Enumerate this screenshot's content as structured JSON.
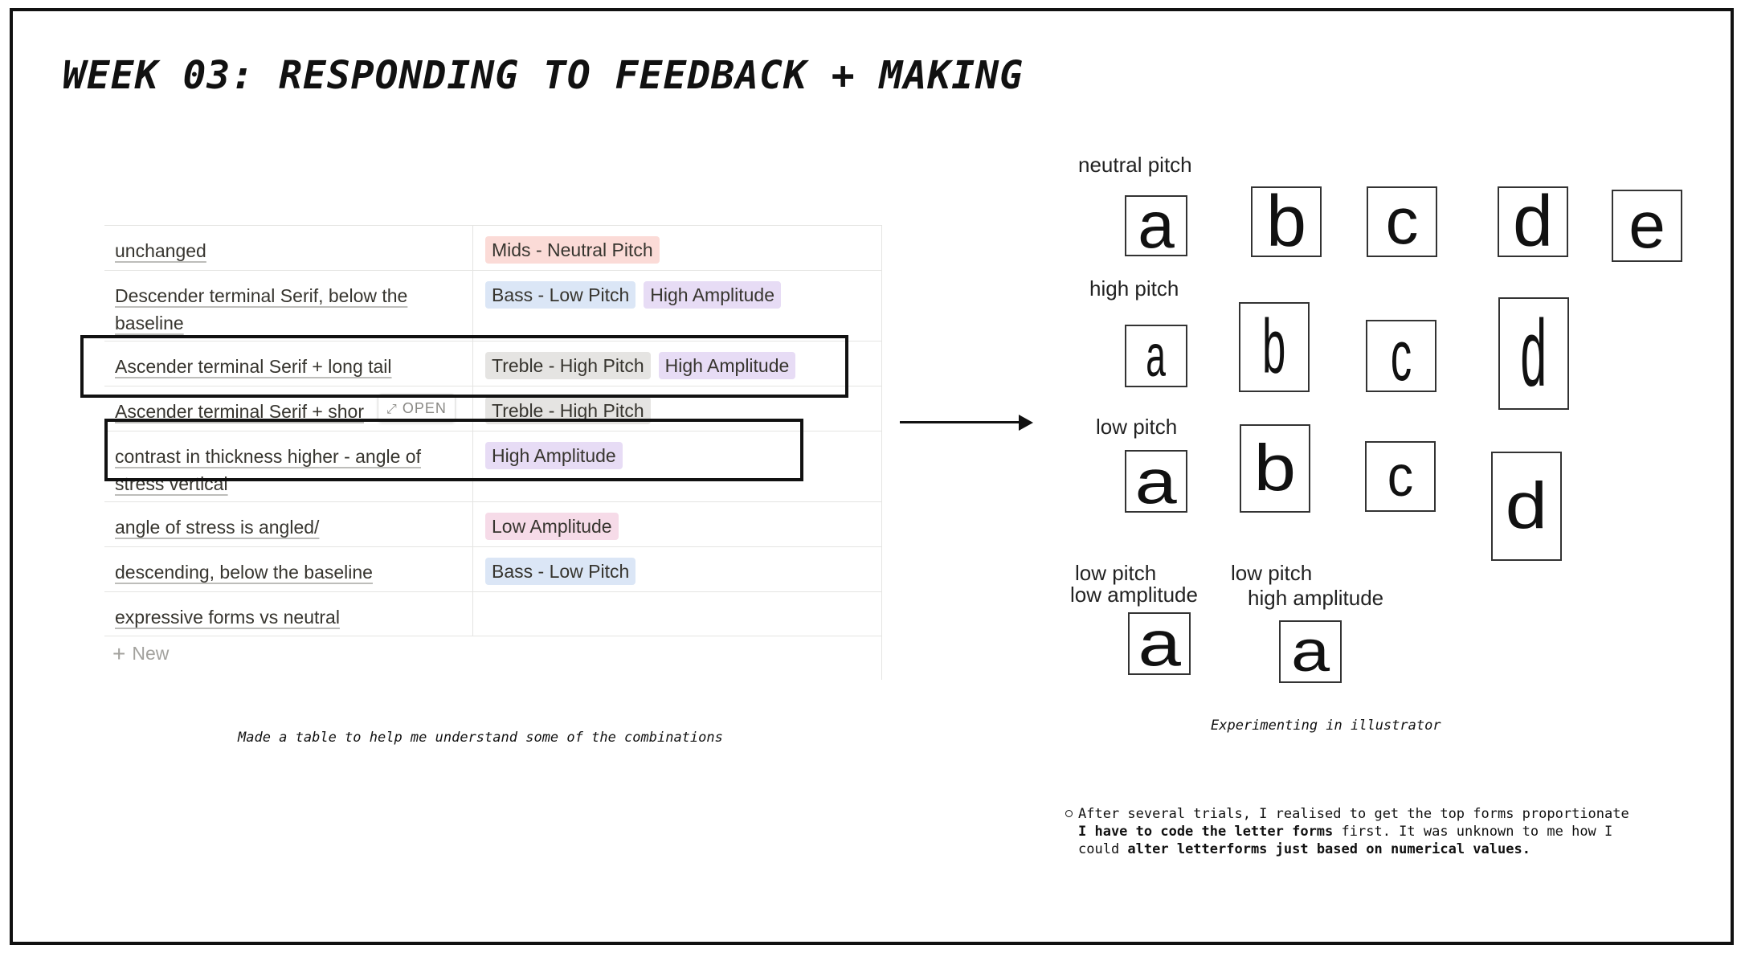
{
  "title": "WEEK 03: RESPONDING TO FEEDBACK + MAKING",
  "table": {
    "rows": [
      {
        "name": "unchanged",
        "tags": [
          {
            "label": "Mids - Neutral Pitch",
            "color": "red"
          }
        ]
      },
      {
        "name": "Descender terminal Serif, below the baseline",
        "tags": [
          {
            "label": "Bass - Low Pitch",
            "color": "blue"
          },
          {
            "label": "High Amplitude",
            "color": "purple"
          }
        ]
      },
      {
        "name": "Ascender terminal Serif + long tail",
        "tags": [
          {
            "label": "Treble - High Pitch",
            "color": "gray"
          },
          {
            "label": "High Amplitude",
            "color": "purple"
          }
        ]
      },
      {
        "name": "Ascender terminal Serif + shor",
        "tags": [
          {
            "label": "Treble - High Pitch",
            "color": "gray"
          }
        ]
      },
      {
        "name": "contrast in thickness higher - angle of stress vertical",
        "tags": [
          {
            "label": "High Amplitude",
            "color": "purple"
          }
        ]
      },
      {
        "name": "angle of stress is angled/",
        "tags": [
          {
            "label": "Low Amplitude",
            "color": "pink"
          }
        ]
      },
      {
        "name": "descending, below the baseline",
        "tags": [
          {
            "label": "Bass - Low Pitch",
            "color": "blue"
          }
        ]
      },
      {
        "name": "expressive forms vs neutral",
        "tags": []
      }
    ],
    "open_label": "OPEN",
    "new_label": "New",
    "caption": "Made a table to help me understand some of the combinations"
  },
  "illustrator": {
    "labels": {
      "neutral": "neutral pitch",
      "high": "high pitch",
      "low": "low pitch",
      "low_low_1": "low pitch",
      "low_low_2": "low amplitude",
      "low_high_1": "low pitch",
      "low_high_2": "high amplitude"
    },
    "glyphs": {
      "neutral": [
        "a",
        "b",
        "c",
        "d",
        "e"
      ],
      "high": [
        "a",
        "b",
        "c",
        "d"
      ],
      "low": [
        "a",
        "b",
        "c",
        "d"
      ],
      "low_low": "a",
      "low_high": "a"
    },
    "caption": "Experimenting in illustrator"
  },
  "note": {
    "t1": "After several trials, I realised to get the top forms proportionate ",
    "b1": "I have to code the letter forms",
    "t2": " first. It was unknown to me how I could ",
    "b2": "alter letterforms just based on numerical values."
  },
  "colors": {
    "red": "#fbdbd7",
    "blue": "#dbe6f6",
    "purple": "#e7dcf5",
    "gray": "#e5e4e2",
    "pink": "#f6dbe8"
  }
}
